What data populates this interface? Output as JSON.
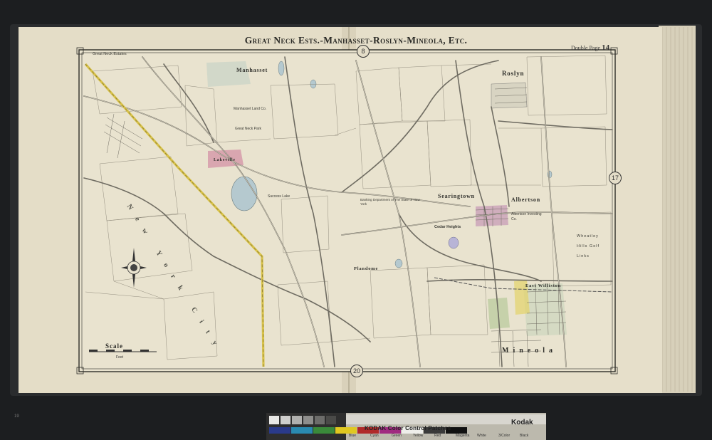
{
  "map": {
    "title": "Great Neck Ests.-Manhasset-Roslyn-Mineola, Etc.",
    "page_label_prefix": "Double Page",
    "page_label_number": "14",
    "adjoining_pages": {
      "top": "8",
      "right": "17",
      "bottom": "20"
    },
    "scale_label": "Scale",
    "scale_unit": "Feet",
    "places": [
      {
        "name": "Great Neck Estates",
        "kind": "estate"
      },
      {
        "name": "Manhasset",
        "kind": "town"
      },
      {
        "name": "Roslyn",
        "kind": "town"
      },
      {
        "name": "Searingtown",
        "kind": "town"
      },
      {
        "name": "Albertson",
        "kind": "town"
      },
      {
        "name": "Cedar Heights",
        "kind": "town"
      },
      {
        "name": "Lakeville",
        "kind": "town"
      },
      {
        "name": "Plandome",
        "kind": "town"
      },
      {
        "name": "East Williston",
        "kind": "town"
      },
      {
        "name": "Mineola",
        "kind": "town"
      },
      {
        "name": "New York City",
        "kind": "city"
      },
      {
        "name": "Manhasset Land Co.",
        "kind": "tract"
      },
      {
        "name": "Great Neck Park",
        "kind": "tract"
      },
      {
        "name": "Success Lake",
        "kind": "tract"
      },
      {
        "name": "Banking Department of The State of New York",
        "kind": "tract"
      },
      {
        "name": "Albertson Investing Co.",
        "kind": "tract"
      },
      {
        "name": "Wheatley Hills Golf Links",
        "kind": "tract"
      }
    ]
  },
  "target_strip": {
    "title": "KODAK Color Control Patches",
    "brand": "Kodak",
    "patches": [
      {
        "label": "Blue",
        "color": "#2a3a8a"
      },
      {
        "label": "Cyan",
        "color": "#2a8ab0"
      },
      {
        "label": "Green",
        "color": "#3a8a3a"
      },
      {
        "label": "Yellow",
        "color": "#e0c820"
      },
      {
        "label": "Red",
        "color": "#b02a2a"
      },
      {
        "label": "Magenta",
        "color": "#a02a80"
      },
      {
        "label": "White",
        "color": "#eeeeea"
      },
      {
        "label": "3/Color",
        "color": "#3a3a3a"
      },
      {
        "label": "Black",
        "color": "#111111"
      }
    ]
  },
  "corner_note": "19",
  "colors": {
    "paper": "#e6dfca",
    "road": "#7a7a72",
    "rail_yellow": "#d8c24a",
    "water": "#b5c9cf",
    "pink_tract": "#d9a6b0"
  }
}
